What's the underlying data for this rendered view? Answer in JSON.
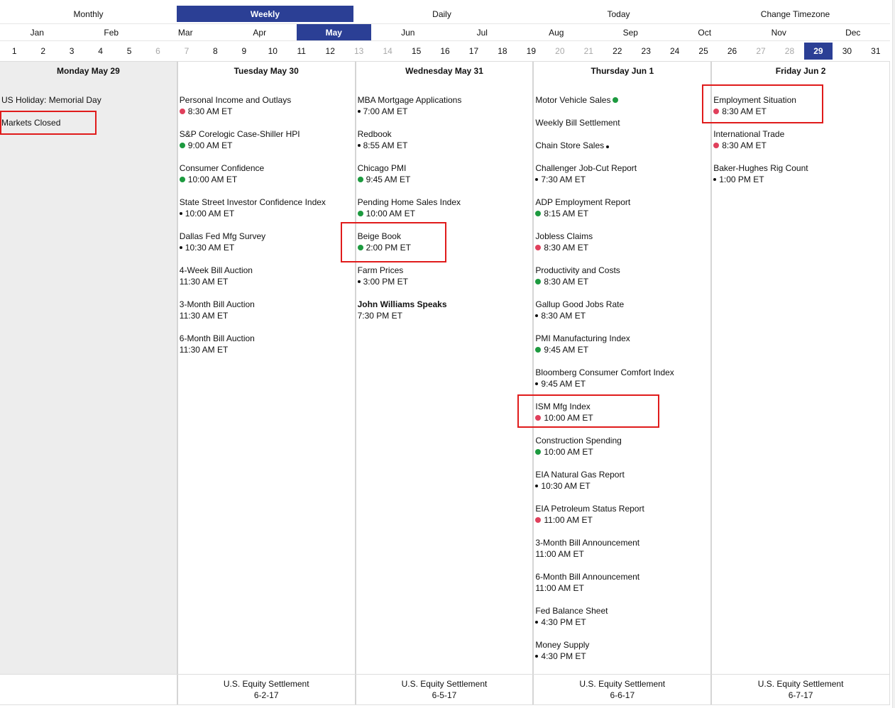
{
  "views": [
    {
      "label": "Monthly",
      "active": false
    },
    {
      "label": "Weekly",
      "active": true
    },
    {
      "label": "Daily",
      "active": false
    },
    {
      "label": "Today",
      "active": false
    },
    {
      "label": "Change Timezone",
      "active": false
    }
  ],
  "months": [
    {
      "label": "Jan"
    },
    {
      "label": "Feb"
    },
    {
      "label": "Mar"
    },
    {
      "label": "Apr"
    },
    {
      "label": "May",
      "active": true
    },
    {
      "label": "Jun"
    },
    {
      "label": "Jul"
    },
    {
      "label": "Aug"
    },
    {
      "label": "Sep"
    },
    {
      "label": "Oct"
    },
    {
      "label": "Nov"
    },
    {
      "label": "Dec"
    }
  ],
  "days": [
    {
      "n": "1"
    },
    {
      "n": "2"
    },
    {
      "n": "3"
    },
    {
      "n": "4"
    },
    {
      "n": "5"
    },
    {
      "n": "6",
      "muted": true
    },
    {
      "n": "7",
      "muted": true
    },
    {
      "n": "8"
    },
    {
      "n": "9"
    },
    {
      "n": "10"
    },
    {
      "n": "11"
    },
    {
      "n": "12"
    },
    {
      "n": "13",
      "muted": true
    },
    {
      "n": "14",
      "muted": true
    },
    {
      "n": "15"
    },
    {
      "n": "16"
    },
    {
      "n": "17"
    },
    {
      "n": "18"
    },
    {
      "n": "19"
    },
    {
      "n": "20",
      "muted": true
    },
    {
      "n": "21",
      "muted": true
    },
    {
      "n": "22"
    },
    {
      "n": "23"
    },
    {
      "n": "24"
    },
    {
      "n": "25"
    },
    {
      "n": "26"
    },
    {
      "n": "27",
      "muted": true
    },
    {
      "n": "28",
      "muted": true
    },
    {
      "n": "29",
      "active": true
    },
    {
      "n": "30"
    },
    {
      "n": "31"
    }
  ],
  "week": {
    "monday": {
      "header": "Monday May 29",
      "holiday": "US Holiday: Memorial Day",
      "closed": "Markets Closed"
    },
    "tuesday": {
      "header": "Tuesday May 30",
      "events": [
        {
          "name": "Personal Income and Outlays",
          "time": "8:30 AM ET",
          "dot": "red"
        },
        {
          "name": "S&P Corelogic Case-Shiller HPI",
          "time": "9:00 AM ET",
          "dot": "green"
        },
        {
          "name": "Consumer Confidence",
          "time": "10:00 AM ET",
          "dot": "green"
        },
        {
          "name": "State Street Investor Confidence Index",
          "time": "10:00 AM ET",
          "dot": "black"
        },
        {
          "name": "Dallas Fed Mfg Survey",
          "time": "10:30 AM ET",
          "dot": "black"
        },
        {
          "name": "4-Week Bill Auction",
          "time": "11:30 AM ET",
          "dot": "none"
        },
        {
          "name": "3-Month Bill Auction",
          "time": "11:30 AM ET",
          "dot": "none"
        },
        {
          "name": "6-Month Bill Auction",
          "time": "11:30 AM ET",
          "dot": "none"
        }
      ]
    },
    "wednesday": {
      "header": "Wednesday May 31",
      "events": [
        {
          "name": "MBA Mortgage Applications",
          "time": "7:00 AM ET",
          "dot": "black"
        },
        {
          "name": "Redbook",
          "time": "8:55 AM ET",
          "dot": "black"
        },
        {
          "name": "Chicago PMI",
          "time": "9:45 AM ET",
          "dot": "green"
        },
        {
          "name": "Pending Home Sales Index",
          "time": "10:00 AM ET",
          "dot": "green"
        },
        {
          "name": "Beige Book",
          "time": "2:00 PM ET",
          "dot": "green"
        },
        {
          "name": "Farm Prices",
          "time": "3:00 PM ET",
          "dot": "black"
        },
        {
          "name": "John Williams Speaks",
          "time": "7:30 PM ET",
          "dot": "none",
          "bold": true
        }
      ]
    },
    "thursday": {
      "header": "Thursday Jun 1",
      "simple": [
        {
          "name": "Motor Vehicle Sales",
          "dot": "green"
        },
        {
          "name": "Weekly Bill Settlement",
          "dot": "none"
        },
        {
          "name": "Chain Store Sales",
          "dot": "black"
        }
      ],
      "events": [
        {
          "name": "Challenger Job-Cut Report",
          "time": "7:30 AM ET",
          "dot": "black"
        },
        {
          "name": "ADP Employment Report",
          "time": "8:15 AM ET",
          "dot": "green"
        },
        {
          "name": "Jobless Claims",
          "time": "8:30 AM ET",
          "dot": "red"
        },
        {
          "name": "Productivity and Costs",
          "time": "8:30 AM ET",
          "dot": "green"
        },
        {
          "name": "Gallup Good Jobs Rate",
          "time": "8:30 AM ET",
          "dot": "black"
        },
        {
          "name": "PMI Manufacturing Index",
          "time": "9:45 AM ET",
          "dot": "green"
        },
        {
          "name": "Bloomberg Consumer Comfort Index",
          "time": "9:45 AM ET",
          "dot": "black"
        },
        {
          "name": "ISM Mfg Index",
          "time": "10:00 AM ET",
          "dot": "red"
        },
        {
          "name": "Construction Spending",
          "time": "10:00 AM ET",
          "dot": "green"
        },
        {
          "name": "EIA Natural Gas Report",
          "time": "10:30 AM ET",
          "dot": "black"
        },
        {
          "name": "EIA Petroleum Status Report",
          "time": "11:00 AM ET",
          "dot": "red"
        },
        {
          "name": "3-Month Bill Announcement",
          "time": "11:00 AM ET",
          "dot": "none"
        },
        {
          "name": "6-Month Bill Announcement",
          "time": "11:00 AM ET",
          "dot": "none"
        },
        {
          "name": "Fed Balance Sheet",
          "time": "4:30 PM ET",
          "dot": "black"
        },
        {
          "name": "Money Supply",
          "time": "4:30 PM ET",
          "dot": "black"
        }
      ]
    },
    "friday": {
      "header": "Friday Jun 2",
      "events": [
        {
          "name": "Employment Situation",
          "time": "8:30 AM ET",
          "dot": "red"
        },
        {
          "name": "International Trade",
          "time": "8:30 AM ET",
          "dot": "red"
        },
        {
          "name": "Baker-Hughes Rig Count",
          "time": "1:00 PM ET",
          "dot": "black"
        }
      ]
    }
  },
  "footer": [
    {
      "label": "",
      "date": ""
    },
    {
      "label": "U.S. Equity Settlement",
      "date": "6-2-17"
    },
    {
      "label": "U.S. Equity Settlement",
      "date": "6-5-17"
    },
    {
      "label": "U.S. Equity Settlement",
      "date": "6-6-17"
    },
    {
      "label": "U.S. Equity Settlement",
      "date": "6-7-17"
    }
  ],
  "colors": {
    "accent": "#2b3f95",
    "dot_red": "#e0405c",
    "dot_green": "#1d9a3f",
    "dot_black": "#111111",
    "highlight": "#e01b1b",
    "holiday_bg": "#ededed"
  }
}
